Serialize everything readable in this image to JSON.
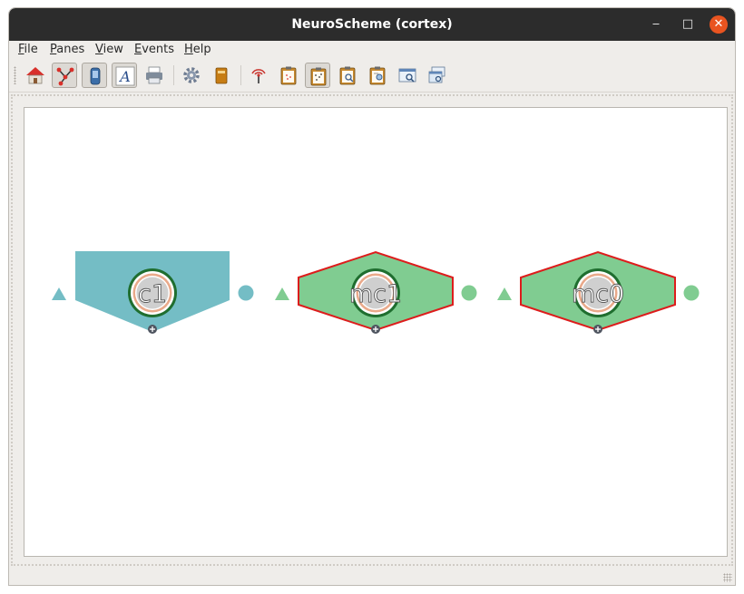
{
  "window": {
    "title": "NeuroScheme (cortex)"
  },
  "window_buttons": {
    "minimize": "‒",
    "maximize": "□",
    "close": "✕"
  },
  "menubar": [
    {
      "mnemonic": "F",
      "rest": "ile"
    },
    {
      "mnemonic": "P",
      "rest": "anes"
    },
    {
      "mnemonic": "V",
      "rest": "iew"
    },
    {
      "mnemonic": "E",
      "rest": "vents"
    },
    {
      "mnemonic": "H",
      "rest": "elp"
    }
  ],
  "toolbar": [
    {
      "icon": "home-icon",
      "checked": false
    },
    {
      "icon": "connect-icon",
      "checked": true
    },
    {
      "icon": "phone-icon",
      "checked": true
    },
    {
      "icon": "text-icon",
      "checked": true,
      "glyph": "A"
    },
    {
      "icon": "printer-icon",
      "checked": false
    },
    {
      "icon": "gear-icon",
      "checked": false
    },
    {
      "icon": "book-icon",
      "checked": false
    },
    {
      "icon": "broadcast-icon",
      "checked": false
    },
    {
      "icon": "clipboard-icon",
      "checked": false
    },
    {
      "icon": "clipboard-scatter-icon",
      "checked": true
    },
    {
      "icon": "clipboard-search-icon",
      "checked": false
    },
    {
      "icon": "clipboard-list-icon",
      "checked": false
    },
    {
      "icon": "window-search-icon",
      "checked": false
    },
    {
      "icon": "window-stack-icon",
      "checked": false
    }
  ],
  "colors": {
    "column_fill": "#74bdc5",
    "minicolumn_fill": "#80cc91",
    "minicolumn_stroke": "#dd1c1c",
    "ring_green": "#1f6e2f",
    "ring_salmon": "#e9a98a",
    "core_gray": "#cfcfcf",
    "expand_dot": "#4f5560",
    "label_color": "#ffffff"
  },
  "scene": {
    "entities": [
      {
        "label": "c1",
        "kind": "column"
      },
      {
        "label": "mc1",
        "kind": "minicolumn"
      },
      {
        "label": "mc0",
        "kind": "minicolumn"
      }
    ]
  }
}
